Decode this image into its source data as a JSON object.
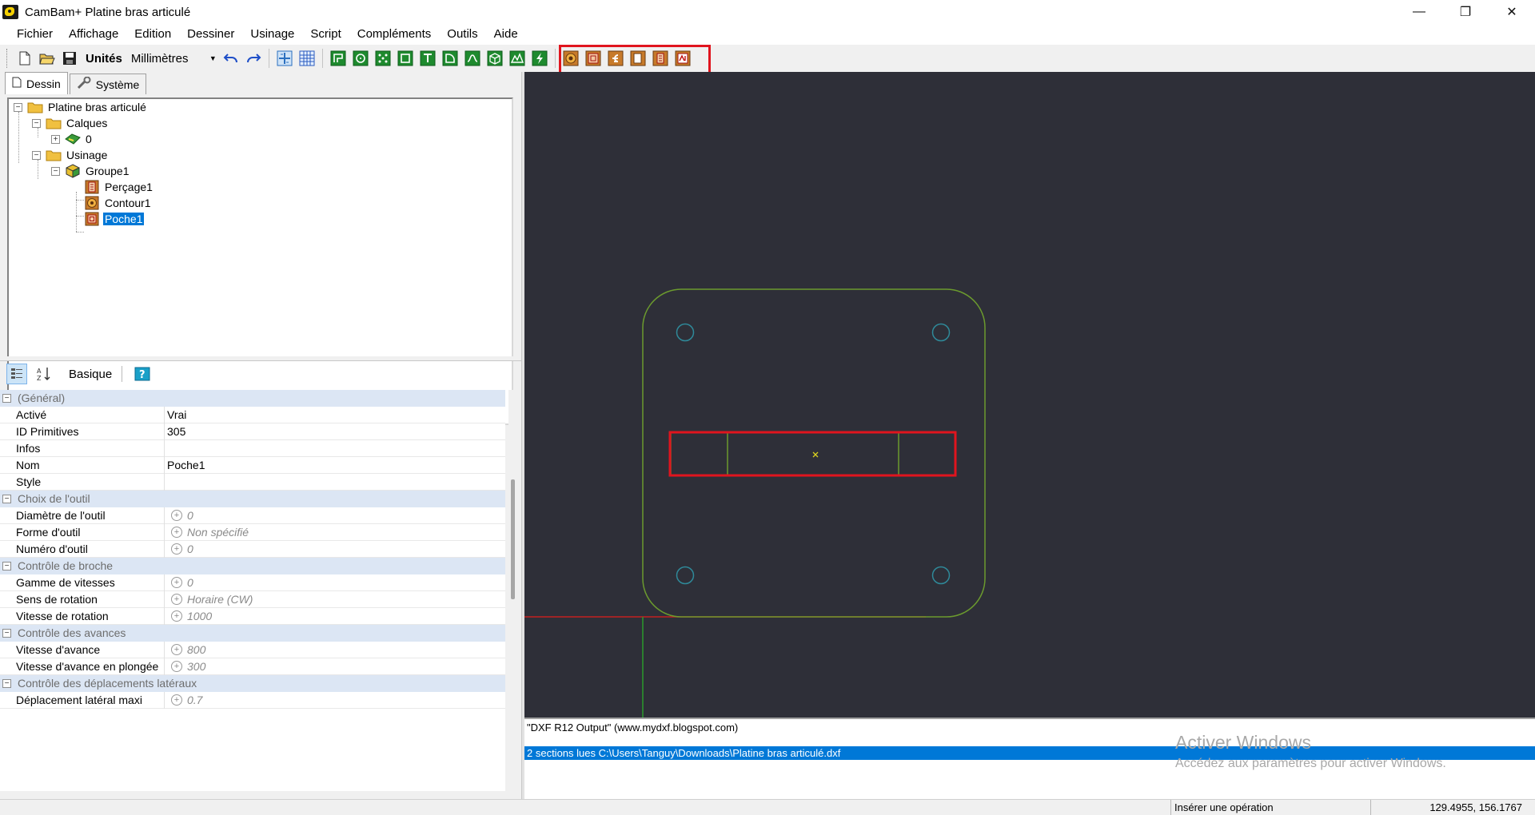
{
  "window": {
    "title": "CamBam+  Platine bras articulé",
    "controls": [
      "—",
      "❐",
      "✕"
    ]
  },
  "menu": [
    "Fichier",
    "Affichage",
    "Edition",
    "Dessiner",
    "Usinage",
    "Script",
    "Compléments",
    "Outils",
    "Aide"
  ],
  "toolbar": {
    "units_label": "Unités",
    "units_value": "Millimètres"
  },
  "tabs": {
    "drawing": "Dessin",
    "system": "Système"
  },
  "tree": {
    "root": "Platine bras articulé",
    "layers": "Calques",
    "layer0": "0",
    "machining": "Usinage",
    "group": "Groupe1",
    "drill": "Perçage1",
    "profile": "Contour1",
    "pocket": "Poche1"
  },
  "props_toolbar": {
    "mode": "Basique"
  },
  "properties": {
    "cat_general": "(Général)",
    "enabled_label": "Activé",
    "enabled_value": "Vrai",
    "prim_label": "ID Primitives",
    "prim_value": "305",
    "info_label": "Infos",
    "info_value": "",
    "name_label": "Nom",
    "name_value": "Poche1",
    "style_label": "Style",
    "style_value": "",
    "cat_tool": "Choix de l'outil",
    "tooldiam_label": "Diamètre de l'outil",
    "tooldiam_value": "0",
    "toolshape_label": "Forme d'outil",
    "toolshape_value": "Non spécifié",
    "toolnum_label": "Numéro d'outil",
    "toolnum_value": "0",
    "cat_spindle": "Contrôle de broche",
    "speedrange_label": "Gamme de vitesses",
    "speedrange_value": "0",
    "rotdir_label": "Sens de rotation",
    "rotdir_value": "Horaire (CW)",
    "rotspeed_label": "Vitesse de rotation",
    "rotspeed_value": "1000",
    "cat_feeds": "Contrôle des avances",
    "feed_label": "Vitesse d'avance",
    "feed_value": "800",
    "plunge_label": "Vitesse d'avance en plongée",
    "plunge_value": "300",
    "cat_lateral": "Contrôle des déplacements latéraux",
    "stepover_label": "Déplacement latéral maxi",
    "stepover_value": "0.7"
  },
  "log": {
    "line1": "\"DXF R12 Output\" (www.mydxf.blogspot.com)",
    "line2": "2 sections lues C:\\Users\\Tanguy\\Downloads\\Platine bras articulé.dxf"
  },
  "watermark": {
    "title": "Activer Windows",
    "subtitle": "Accédez aux paramètres pour activer Windows."
  },
  "status": {
    "hint": "Insérer une opération",
    "coords": "129.4955, 156.1767"
  },
  "colors": {
    "canvas_bg": "#2e2f38",
    "outline": "#6b9a2e",
    "holes": "#2f8a9a",
    "highlight": "#e0141e",
    "selection": "#0078d7"
  }
}
